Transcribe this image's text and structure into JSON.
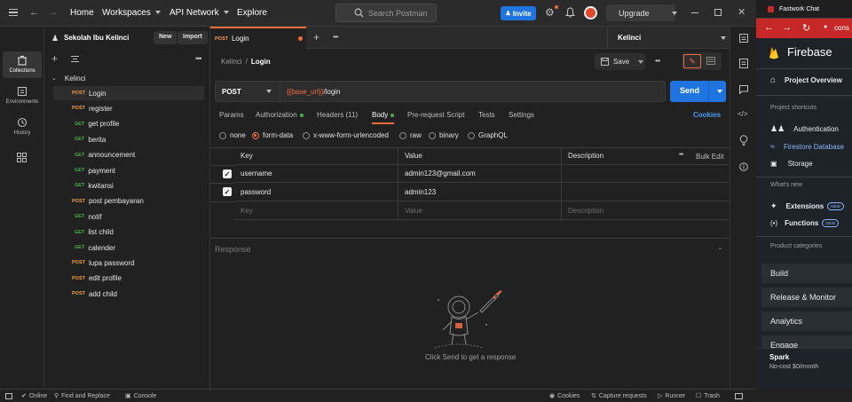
{
  "topbar": {
    "home": "Home",
    "workspaces": "Workspaces",
    "api_network": "API Network",
    "explore": "Explore",
    "search_placeholder": "Search Postman",
    "invite": "Invite",
    "upgrade": "Upgrade"
  },
  "rail": {
    "collections": "Collections",
    "environments": "Environments",
    "history": "History"
  },
  "sidebar": {
    "workspace_name": "Sekolah Ibu Kelinci",
    "new_label": "New",
    "import_label": "Import",
    "collection_name": "Kelinci",
    "items": [
      {
        "method": "POST",
        "name": "Login"
      },
      {
        "method": "POST",
        "name": "register"
      },
      {
        "method": "GET",
        "name": "get profile"
      },
      {
        "method": "GET",
        "name": "berita"
      },
      {
        "method": "GET",
        "name": "announcement"
      },
      {
        "method": "GET",
        "name": "payment"
      },
      {
        "method": "GET",
        "name": "kwitansi"
      },
      {
        "method": "POST",
        "name": "post pembayaran"
      },
      {
        "method": "GET",
        "name": "notif"
      },
      {
        "method": "GET",
        "name": "list child"
      },
      {
        "method": "GET",
        "name": "calender"
      },
      {
        "method": "POST",
        "name": "lupa password"
      },
      {
        "method": "POST",
        "name": "edit profile"
      },
      {
        "method": "POST",
        "name": "add child"
      }
    ]
  },
  "tabbar": {
    "tab_method": "POST",
    "tab_name": "Login",
    "environment": "Kelinci"
  },
  "request": {
    "breadcrumb_parent": "Kelinci",
    "breadcrumb_sep": "/",
    "breadcrumb_current": "Login",
    "save": "Save",
    "method": "POST",
    "url_var": "{{base_url}}",
    "url_path": "/login",
    "send": "Send"
  },
  "subtabs": {
    "params": "Params",
    "authorization": "Authorization",
    "headers": "Headers (11)",
    "body": "Body",
    "prerequest": "Pre-request Script",
    "tests": "Tests",
    "settings": "Settings",
    "cookies": "Cookies"
  },
  "body_types": [
    "none",
    "form-data",
    "x-www-form-urlencoded",
    "raw",
    "binary",
    "GraphQL"
  ],
  "table": {
    "headers": [
      "Key",
      "Value",
      "Description"
    ],
    "bulk_edit": "Bulk Edit",
    "rows": [
      {
        "key": "username",
        "value": "admin123@gmail.com",
        "description": ""
      },
      {
        "key": "password",
        "value": "admin123",
        "description": ""
      }
    ],
    "placeholder": {
      "key": "Key",
      "value": "Value",
      "description": "Description"
    }
  },
  "response": {
    "title": "Response",
    "empty_text": "Click Send to get a response"
  },
  "statusbar": {
    "online": "Online",
    "find_replace": "Find and Replace",
    "console": "Console",
    "cookies": "Cookies",
    "capture": "Capture requests",
    "runner": "Runner",
    "trash": "Trash"
  },
  "firebase": {
    "window_title": "Fastwork Chat",
    "url_fragment": "cons",
    "brand": "Firebase",
    "project_overview": "Project Overview",
    "shortcuts_label": "Project shortcuts",
    "authentication": "Authentication",
    "firestore": "Firestore Database",
    "storage": "Storage",
    "whats_new": "What's new",
    "extensions": "Extensions",
    "functions": "Functions",
    "new_badge": "NEW",
    "categories_label": "Product categories",
    "build": "Build",
    "release": "Release & Monitor",
    "analytics": "Analytics",
    "engage": "Engage",
    "plan_name": "Spark",
    "plan_desc": "No-cost $0/month"
  },
  "colors": {
    "accent": "#f26b3a",
    "send_blue": "#1f74e0",
    "post": "#f29d49",
    "get": "#4caf50",
    "firebase_red": "#c62828"
  }
}
